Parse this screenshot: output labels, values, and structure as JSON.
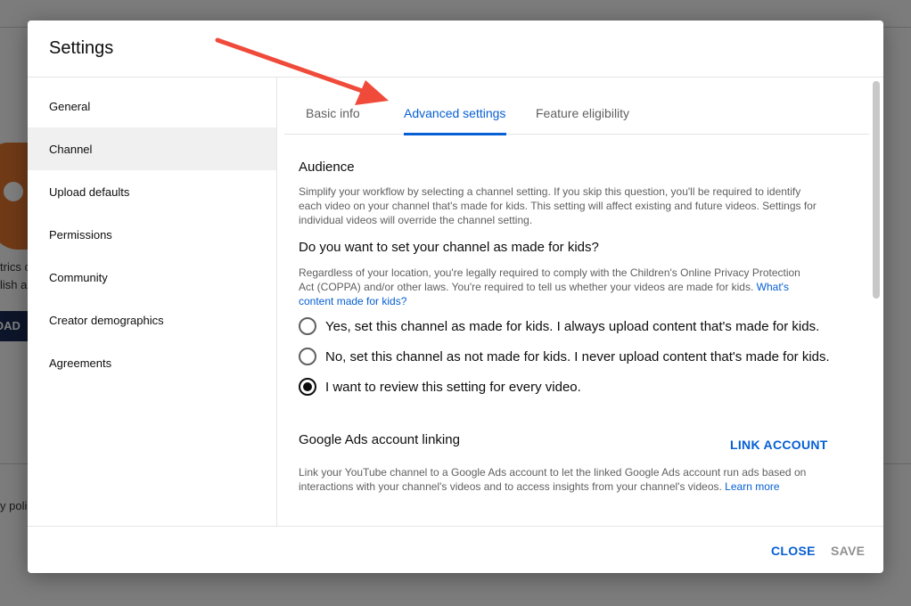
{
  "background": {
    "fragments": [
      "trics c",
      "lish a",
      "OAD",
      "y polic"
    ]
  },
  "dialog": {
    "title": "Settings",
    "sidebar": {
      "items": [
        {
          "label": "General"
        },
        {
          "label": "Channel",
          "active": true
        },
        {
          "label": "Upload defaults"
        },
        {
          "label": "Permissions"
        },
        {
          "label": "Community"
        },
        {
          "label": "Creator demographics"
        },
        {
          "label": "Agreements"
        }
      ]
    },
    "tabs": [
      {
        "label": "Basic info"
      },
      {
        "label": "Advanced settings",
        "active": true
      },
      {
        "label": "Feature eligibility"
      }
    ],
    "audience": {
      "title": "Audience",
      "description": "Simplify your workflow by selecting a channel setting. If you skip this question, you'll be required to identify each video on your channel that's made for kids. This setting will affect existing and future videos. Settings for individual videos will override the channel setting.",
      "question": "Do you want to set your channel as made for kids?",
      "legal_text": "Regardless of your location, you're legally required to comply with the Children's Online Privacy Protection Act (COPPA) and/or other laws. You're required to tell us whether your videos are made for kids. ",
      "legal_link": "What's content made for kids?",
      "options": [
        {
          "label": "Yes, set this channel as made for kids. I always upload content that's made for kids.",
          "checked": false
        },
        {
          "label": "No, set this channel as not made for kids. I never upload content that's made for kids.",
          "checked": false
        },
        {
          "label": "I want to review this setting for every video.",
          "checked": true
        }
      ]
    },
    "google_ads": {
      "title": "Google Ads account linking",
      "link_button": "LINK ACCOUNT",
      "description": "Link your YouTube channel to a Google Ads account to let the linked Google Ads account run ads based on interactions with your channel's videos and to access insights from your channel's videos. ",
      "learn_more": "Learn more"
    },
    "footer": {
      "close_label": "CLOSE",
      "save_label": "SAVE"
    }
  },
  "colors": {
    "accent": "#065fd4",
    "annotation_arrow": "#f04a3a"
  }
}
